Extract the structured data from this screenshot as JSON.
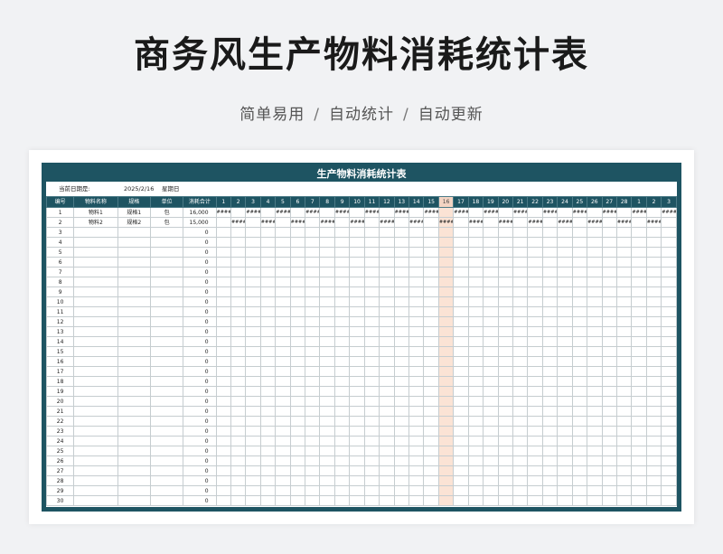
{
  "header": {
    "title": "商务风生产物料消耗统计表",
    "subtitle_parts": [
      "简单易用",
      "自动统计",
      "自动更新"
    ],
    "separator": "/"
  },
  "sheet": {
    "title": "生产物料消耗统计表",
    "date_label": "当前日期是:",
    "date_value": "2025/2/16",
    "weekday": "星期日",
    "columns": {
      "id": "编号",
      "name": "物料名称",
      "spec": "规格",
      "unit": "单位",
      "total": "消耗合计"
    },
    "days": [
      "1",
      "2",
      "3",
      "4",
      "5",
      "6",
      "7",
      "8",
      "9",
      "10",
      "11",
      "12",
      "13",
      "14",
      "15",
      "16",
      "17",
      "18",
      "19",
      "20",
      "21",
      "22",
      "23",
      "24",
      "25",
      "26",
      "27",
      "28",
      "1",
      "2",
      "3"
    ],
    "highlight_day_index": 15,
    "hash_mark": "####",
    "rows": [
      {
        "id": "1",
        "name": "物料1",
        "spec": "规格1",
        "unit": "包",
        "total": "16,000",
        "hash_days": [
          0,
          2,
          4,
          6,
          8,
          10,
          12,
          14,
          16,
          18,
          20,
          22,
          24,
          26,
          28,
          30
        ]
      },
      {
        "id": "2",
        "name": "物料2",
        "spec": "规格2",
        "unit": "包",
        "total": "15,000",
        "hash_days": [
          1,
          3,
          5,
          7,
          9,
          11,
          13,
          15,
          17,
          19,
          21,
          23,
          25,
          27,
          29
        ]
      },
      {
        "id": "3",
        "total": "0"
      },
      {
        "id": "4",
        "total": "0"
      },
      {
        "id": "5",
        "total": "0"
      },
      {
        "id": "6",
        "total": "0"
      },
      {
        "id": "7",
        "total": "0"
      },
      {
        "id": "8",
        "total": "0"
      },
      {
        "id": "9",
        "total": "0"
      },
      {
        "id": "10",
        "total": "0"
      },
      {
        "id": "11",
        "total": "0"
      },
      {
        "id": "12",
        "total": "0"
      },
      {
        "id": "13",
        "total": "0"
      },
      {
        "id": "14",
        "total": "0"
      },
      {
        "id": "15",
        "total": "0"
      },
      {
        "id": "16",
        "total": "0"
      },
      {
        "id": "17",
        "total": "0"
      },
      {
        "id": "18",
        "total": "0"
      },
      {
        "id": "19",
        "total": "0"
      },
      {
        "id": "20",
        "total": "0"
      },
      {
        "id": "21",
        "total": "0"
      },
      {
        "id": "22",
        "total": "0"
      },
      {
        "id": "23",
        "total": "0"
      },
      {
        "id": "24",
        "total": "0"
      },
      {
        "id": "25",
        "total": "0"
      },
      {
        "id": "26",
        "total": "0"
      },
      {
        "id": "27",
        "total": "0"
      },
      {
        "id": "28",
        "total": "0"
      },
      {
        "id": "29",
        "total": "0"
      },
      {
        "id": "30",
        "total": "0"
      }
    ]
  },
  "colors": {
    "accent": "#1e5462",
    "highlight": "#fbe3d5"
  }
}
